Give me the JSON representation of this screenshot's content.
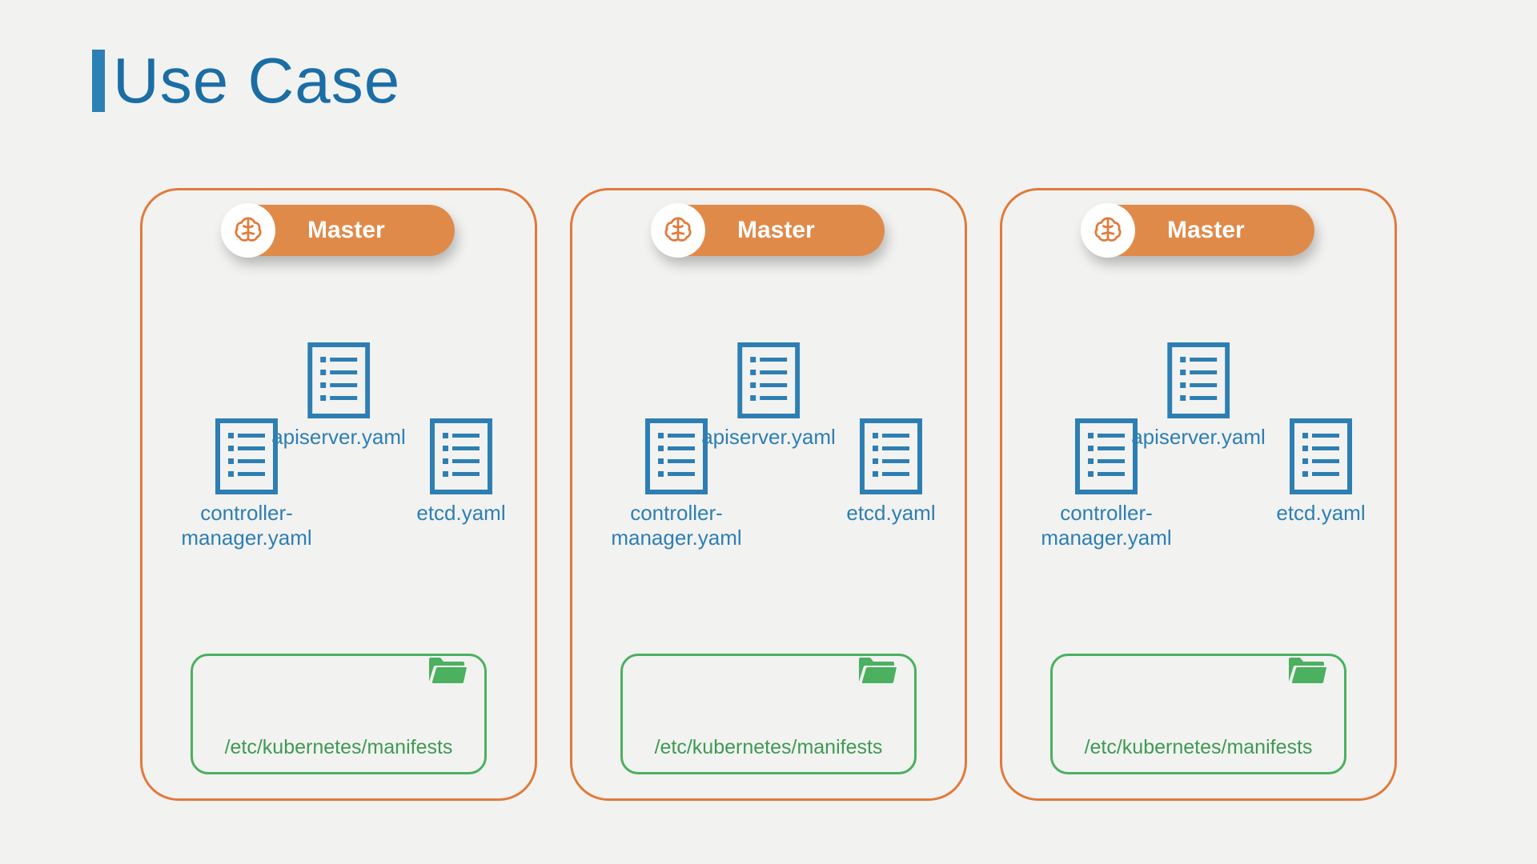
{
  "title": "Use Case",
  "colors": {
    "title": "#1b6ea5",
    "card_border": "#e17a3a",
    "pill": "#e08a4a",
    "file": "#2d7fb3",
    "folder": "#4bb060"
  },
  "cards": [
    {
      "master_label": "Master",
      "files": {
        "center": "apiserver.yaml",
        "left": "controller-\nmanager.yaml",
        "right": "etcd.yaml"
      },
      "folder_path": "/etc/kubernetes/manifests"
    },
    {
      "master_label": "Master",
      "files": {
        "center": "apiserver.yaml",
        "left": "controller-\nmanager.yaml",
        "right": "etcd.yaml"
      },
      "folder_path": "/etc/kubernetes/manifests"
    },
    {
      "master_label": "Master",
      "files": {
        "center": "apiserver.yaml",
        "left": "controller-\nmanager.yaml",
        "right": "etcd.yaml"
      },
      "folder_path": "/etc/kubernetes/manifests"
    }
  ]
}
